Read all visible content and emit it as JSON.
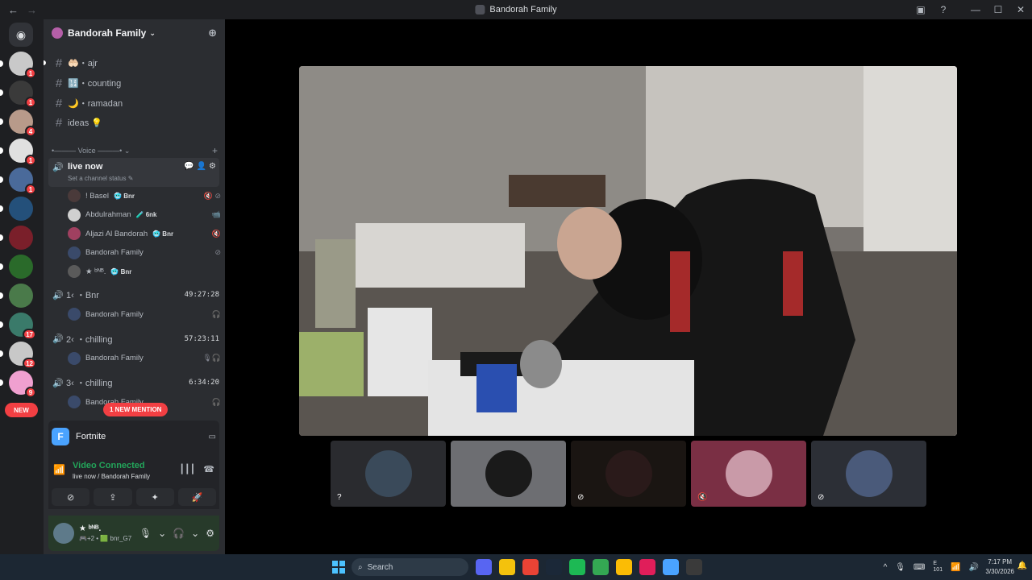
{
  "window": {
    "title": "Bandorah Family",
    "back_icon": "←",
    "forward_icon": "→",
    "controls": [
      "▣",
      "?",
      "—",
      "☐",
      "✕"
    ]
  },
  "rail": {
    "home_label": "◉",
    "servers": [
      {
        "badge": "1",
        "color": "#c9c9c9"
      },
      {
        "badge": "1",
        "color": "#3a3a3a"
      },
      {
        "badge": "4",
        "color": "#b89a8a"
      },
      {
        "badge": "1",
        "color": "#e0e0e0"
      },
      {
        "badge": "1",
        "color": "#4a6a9a"
      },
      {
        "badge": "",
        "color": "#24507a"
      },
      {
        "badge": "",
        "color": "#7a1f2a"
      },
      {
        "badge": "",
        "color": "#2a6a2a"
      },
      {
        "badge": "",
        "color": "#4a7a4a"
      },
      {
        "badge": "17",
        "color": "#3a7a6a"
      },
      {
        "badge": "12",
        "color": "#c8c8c8"
      },
      {
        "badge": "9",
        "color": "#f0a0d0"
      }
    ],
    "new_label": "NEW"
  },
  "guild": {
    "name": "Bandorah Family",
    "chevron": "⌄",
    "add_person_icon": "⊕"
  },
  "channels": [
    {
      "name": "🤲🏻・ajr",
      "unread": true
    },
    {
      "name": "🔢・counting",
      "unread": false
    },
    {
      "name": "🌙・ramadan",
      "unread": false
    },
    {
      "name": "ideas 💡",
      "unread": false
    }
  ],
  "voice_category": {
    "label": "•——— Voice ———• ⌄",
    "plus": "+"
  },
  "active_voice": {
    "name": "live now",
    "status": "Set a channel status ✎",
    "actions": [
      "💬",
      "👤",
      "⚙"
    ],
    "users": [
      {
        "name": "! Basel",
        "tag": "🥶 Bnr",
        "icons": "🔇 ⊘",
        "color": "#4a3a3a"
      },
      {
        "name": "Abdulrahman",
        "tag": "🧪 6nk",
        "icons": "📹",
        "color": "#d0d0d0"
      },
      {
        "name": "Aljazi Al Bandorah",
        "tag": "🥶 Bnr",
        "icons": "🔇",
        "color": "#a04060"
      },
      {
        "name": "Bandorah Family",
        "tag": "",
        "icons": "⊘",
        "color": "#3a4a6a"
      },
      {
        "name": "★    ᵇᴺᴮ.",
        "tag": "🥶 Bnr",
        "icons": "",
        "color": "#5a5a5a"
      }
    ]
  },
  "voice_channels": [
    {
      "name": "1‹ ・Bnr",
      "timer": "49:27:28",
      "user": "Bandorah Family",
      "icons": "🎧"
    },
    {
      "name": "2‹ ・chilling",
      "timer": "57:23:11",
      "user": "Bandorah Family",
      "icons": "🎙🎧"
    },
    {
      "name": "3‹ ・chilling",
      "timer": "6:34:20",
      "user": "Bandorah Family",
      "icons": "🎧"
    }
  ],
  "mention_label": "1 NEW MENTION",
  "activity": {
    "game_name": "Fortnite",
    "game_icon": "F",
    "action_icon": "▭"
  },
  "connection": {
    "status": "Video Connected",
    "location": "live now / Bandorah Family",
    "signal_icon": "📶",
    "noise_icon": "┃┃┃",
    "disconnect_icon": "☎"
  },
  "call_buttons": [
    "⊘",
    "⇪",
    "✦",
    "🚀"
  ],
  "user": {
    "name": "★    ᵇᴺᴮ.",
    "tag": "🎮+2 • 🟩 bnr_G7",
    "mic_icon": "🎙",
    "headset_icon": "🎧",
    "settings_icon": "⚙",
    "chevron": "⌄"
  },
  "thumbnails": [
    {
      "color": "#2a2b2f",
      "avatar": "#3a4a5a",
      "indicator": "?"
    },
    {
      "color": "#6d6e72",
      "avatar": "#1a1a1a",
      "indicator": ""
    },
    {
      "color": "#1a1512",
      "avatar": "#2a1a1a",
      "indicator": "⊘"
    },
    {
      "color": "#7a2f44",
      "avatar": "#c99aa8",
      "indicator": "🔇"
    },
    {
      "color": "#2c2f36",
      "avatar": "#4a5a7a",
      "indicator": "⊘"
    }
  ],
  "taskbar": {
    "search_placeholder": "Search",
    "apps": [
      "#5865f2",
      "#f4c20d",
      "#ea4335",
      "#1b2838",
      "#1db954",
      "#34a853",
      "#fbbc05",
      "#e01e5a",
      "#4aa3ff",
      "#3a3a3a"
    ],
    "tray_icons": [
      "^",
      "🎙",
      "⌨",
      "E\n101",
      "📶",
      "🔊"
    ],
    "time": "7:17 PM",
    "date": "3/30/2026",
    "bell": "🔔"
  }
}
